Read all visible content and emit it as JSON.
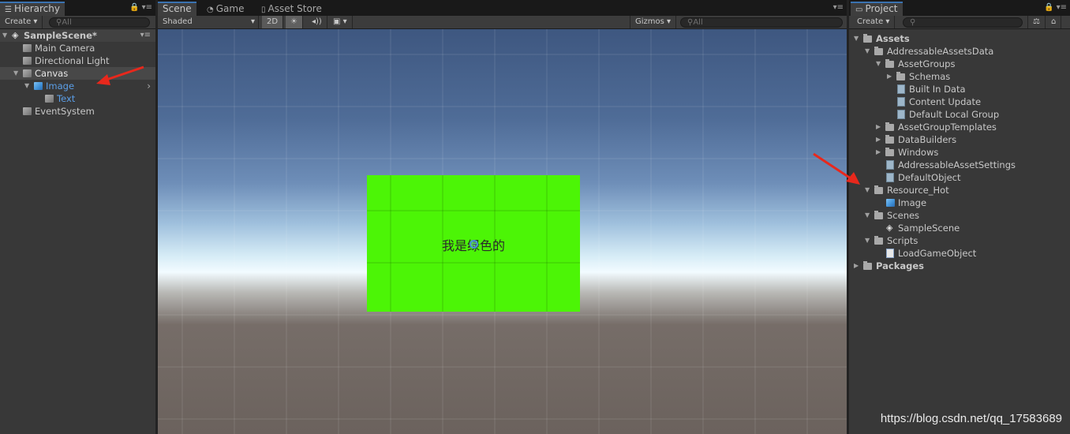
{
  "colors": {
    "accent_blue": "#3a72b0",
    "selected_text_blue": "#5b9fe8",
    "ui_image_green": "#4cf506",
    "annotation_arrow": "#e8281c"
  },
  "hierarchy": {
    "tab_label": "Hierarchy",
    "create_label": "Create",
    "search_placeholder": "All",
    "items": [
      {
        "label": "SampleScene*",
        "icon": "unity-scene-icon"
      },
      {
        "label": "Main Camera",
        "icon": "gameobject-cube-icon"
      },
      {
        "label": "Directional Light",
        "icon": "gameobject-cube-icon"
      },
      {
        "label": "Canvas",
        "icon": "gameobject-cube-icon"
      },
      {
        "label": "Image",
        "icon": "prefab-cube-icon"
      },
      {
        "label": "Text",
        "icon": "gameobject-cube-icon"
      },
      {
        "label": "EventSystem",
        "icon": "gameobject-cube-icon"
      }
    ]
  },
  "scene": {
    "tabs": [
      {
        "label": "Scene",
        "icon": "grid-icon"
      },
      {
        "label": "Game",
        "icon": "pacman-icon"
      },
      {
        "label": "Asset Store",
        "icon": "bag-icon"
      }
    ],
    "shading_mode": "Shaded",
    "toggle_2d": "2D",
    "gizmos_label": "Gizmos",
    "search_placeholder": "All",
    "ui_image_text": "我是绿色的"
  },
  "project": {
    "tab_label": "Project",
    "create_label": "Create",
    "items": [
      {
        "label": "Assets",
        "icon": "folder-icon"
      },
      {
        "label": "AddressableAssetsData",
        "icon": "folder-icon"
      },
      {
        "label": "AssetGroups",
        "icon": "folder-icon"
      },
      {
        "label": "Schemas",
        "icon": "folder-icon"
      },
      {
        "label": "Built In Data",
        "icon": "asset-file-icon"
      },
      {
        "label": "Content Update",
        "icon": "asset-file-icon"
      },
      {
        "label": "Default Local Group",
        "icon": "asset-file-icon"
      },
      {
        "label": "AssetGroupTemplates",
        "icon": "folder-icon"
      },
      {
        "label": "DataBuilders",
        "icon": "folder-icon"
      },
      {
        "label": "Windows",
        "icon": "folder-icon"
      },
      {
        "label": "AddressableAssetSettings",
        "icon": "asset-file-icon"
      },
      {
        "label": "DefaultObject",
        "icon": "asset-file-icon"
      },
      {
        "label": "Resource_Hot",
        "icon": "folder-icon"
      },
      {
        "label": "Image",
        "icon": "prefab-cube-icon"
      },
      {
        "label": "Scenes",
        "icon": "folder-icon"
      },
      {
        "label": "SampleScene",
        "icon": "unity-scene-icon"
      },
      {
        "label": "Scripts",
        "icon": "folder-icon"
      },
      {
        "label": "LoadGameObject",
        "icon": "csharp-script-icon"
      },
      {
        "label": "Packages",
        "icon": "folder-icon"
      }
    ]
  },
  "watermark": "https://blog.csdn.net/qq_17583689"
}
